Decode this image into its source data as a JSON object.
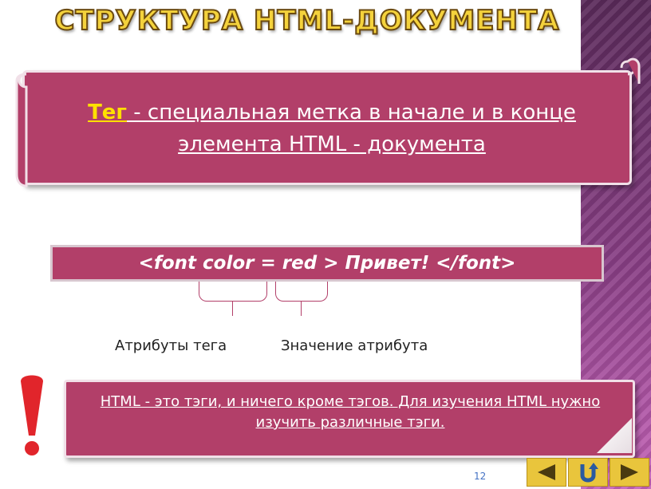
{
  "slide": {
    "title": "СТРУКТУРА HTML-ДОКУМЕНТА",
    "definition": {
      "term": "Тег",
      "text_line1": " - специальная метка в начале и в конце",
      "text_line2": "элемента HTML - документа"
    },
    "code_example": "<font  color = red > Привет! </font>",
    "labels": {
      "tag_attributes": "Атрибуты тега",
      "attribute_value": "Значение атрибута"
    },
    "note_text": "HTML - это тэги, и ничего кроме тэгов. Для изучения HTML нужно изучить различные тэги.",
    "page_number": "12"
  },
  "navigation": {
    "buttons": [
      {
        "icon": "arrow-left-icon"
      },
      {
        "icon": "return-icon"
      },
      {
        "icon": "arrow-right-icon"
      }
    ]
  },
  "colors": {
    "accent": "#b23f69",
    "title_fill": "#f4d23c",
    "term_highlight": "#ffe000",
    "exclamation": "#e1252b",
    "nav_button": "#e9c53c"
  }
}
